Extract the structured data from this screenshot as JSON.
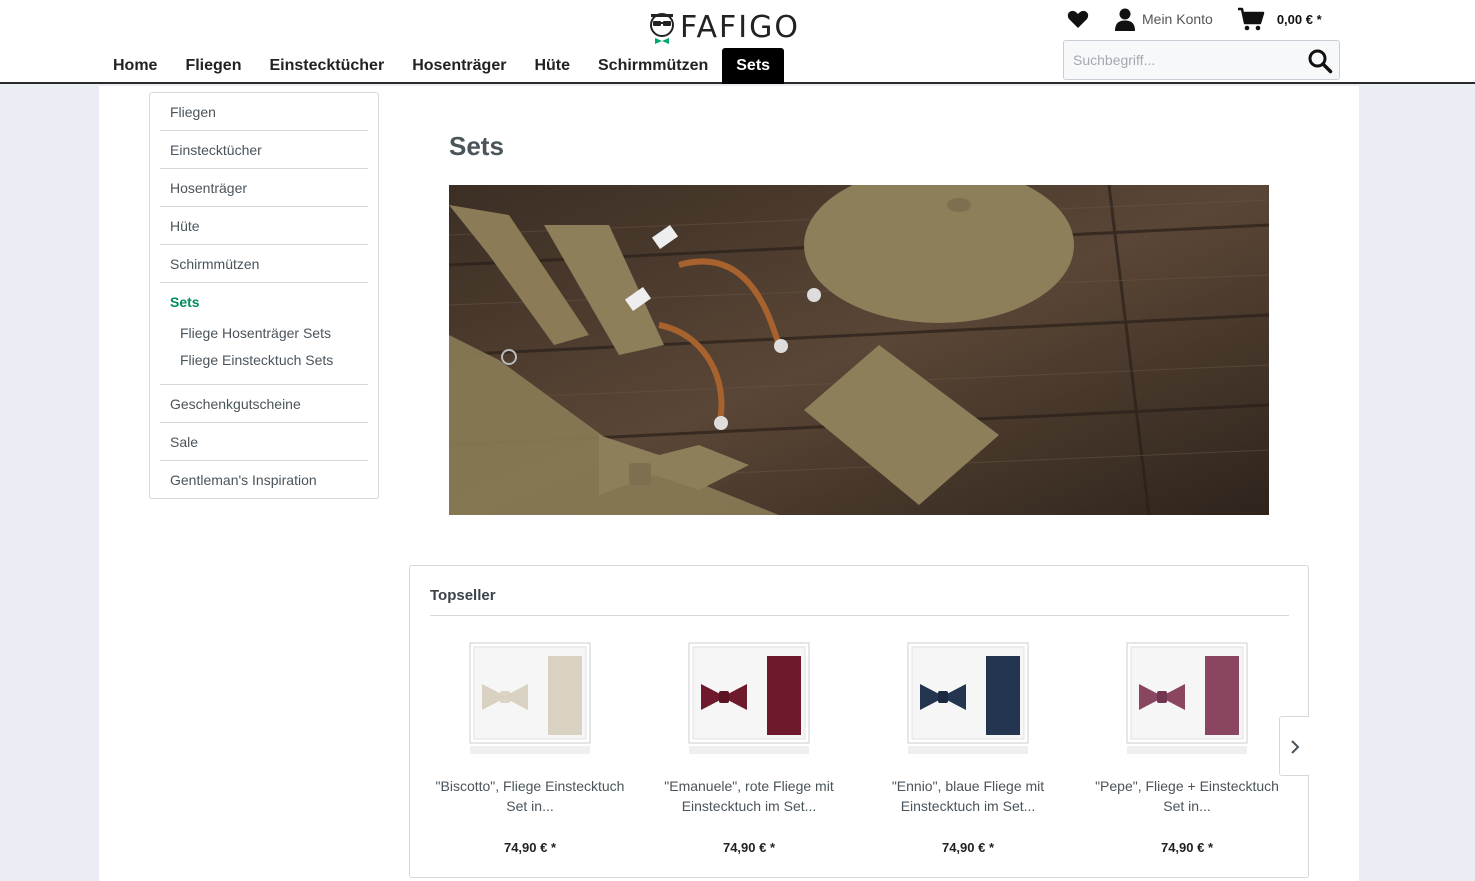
{
  "brand": {
    "name": "FAFIGO"
  },
  "nav": [
    "Home",
    "Fliegen",
    "Einstecktücher",
    "Hosenträger",
    "Hüte",
    "Schirmmützen",
    "Sets"
  ],
  "nav_active": "Sets",
  "header": {
    "account_label": "Mein Konto",
    "cart_price": "0,00 € *",
    "search_placeholder": "Suchbegriff..."
  },
  "sidebar": {
    "items": [
      "Fliegen",
      "Einstecktücher",
      "Hosenträger",
      "Hüte",
      "Schirmmützen",
      "Sets"
    ],
    "sub_items": [
      "Fliege Hosenträger Sets",
      "Fliege Einstecktuch Sets"
    ],
    "more_items": [
      "Geschenkgutscheine",
      "Sale",
      "Gentleman's Inspiration"
    ]
  },
  "page": {
    "title": "Sets"
  },
  "topseller": {
    "title": "Topseller",
    "products": [
      {
        "name": "\"Biscotto\", Fliege Einstecktuch Set in...",
        "price": "74,90 € *",
        "color": "#d9d1c1"
      },
      {
        "name": "\"Emanuele\", rote Fliege mit Einstecktuch im Set...",
        "price": "74,90 € *",
        "color": "#6e1a2c"
      },
      {
        "name": "\"Ennio\", blaue Fliege mit Einstecktuch im Set...",
        "price": "74,90 € *",
        "color": "#24354f"
      },
      {
        "name": "\"Pepe\", Fliege + Einstecktuch Set in...",
        "price": "74,90 € *",
        "color": "#8a4560"
      }
    ]
  },
  "colors": {
    "accent": "#008c5e",
    "text": "#4a545b",
    "background": "#ebedf4"
  },
  "icons": [
    "heart-icon",
    "user-icon",
    "cart-icon",
    "search-icon",
    "chevron-right-icon"
  ]
}
